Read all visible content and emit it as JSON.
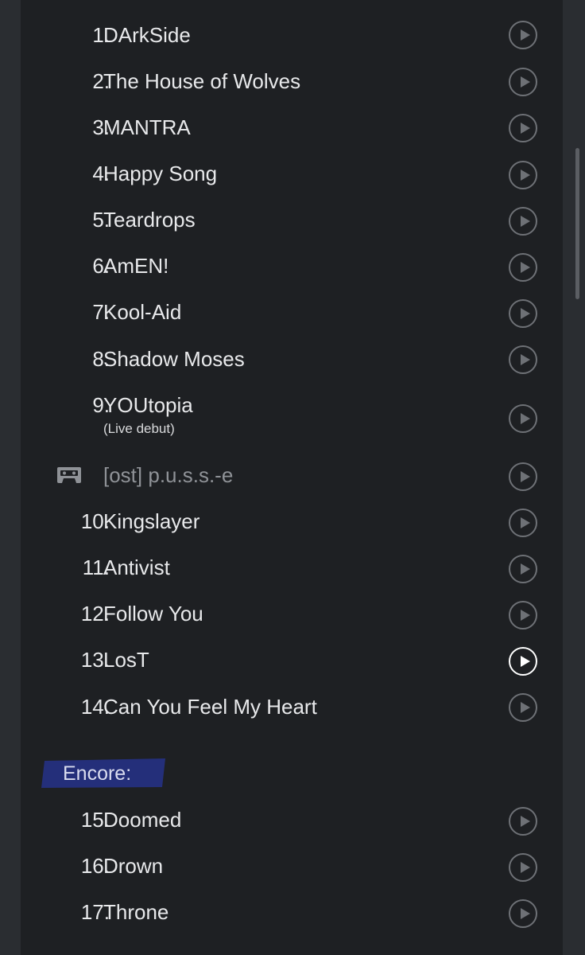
{
  "setlist": {
    "main": [
      {
        "number": "1.",
        "title": "DArkSide"
      },
      {
        "number": "2.",
        "title": "The House of Wolves"
      },
      {
        "number": "3.",
        "title": "MANTRA"
      },
      {
        "number": "4.",
        "title": "Happy Song"
      },
      {
        "number": "5.",
        "title": "Teardrops"
      },
      {
        "number": "6.",
        "title": "AmEN!"
      },
      {
        "number": "7.",
        "title": "Kool-Aid"
      },
      {
        "number": "8.",
        "title": "Shadow Moses"
      },
      {
        "number": "9.",
        "title": "YOUtopia",
        "note": "(Live debut)"
      }
    ],
    "tape": {
      "title": "[ost] p.u.s.s.-e",
      "icon": "cassette-tape-icon"
    },
    "main_cont": [
      {
        "number": "10.",
        "title": "Kingslayer"
      },
      {
        "number": "11.",
        "title": "Antivist"
      },
      {
        "number": "12.",
        "title": "Follow You"
      },
      {
        "number": "13.",
        "title": "LosT",
        "active": true
      },
      {
        "number": "14.",
        "title": "Can You Feel My Heart"
      }
    ],
    "encore_label": "Encore:",
    "encore": [
      {
        "number": "15.",
        "title": "Doomed"
      },
      {
        "number": "16.",
        "title": "Drown"
      },
      {
        "number": "17.",
        "title": "Throne"
      }
    ]
  },
  "icons": {
    "play": "play-circle-icon",
    "tape": "cassette-tape-icon"
  },
  "colors": {
    "background": "#1e2023",
    "frame": "#2a2d31",
    "text": "#e8e9eb",
    "muted_text": "#8f9297",
    "play_icon": "#6e7176",
    "play_icon_active": "#ffffff",
    "encore_highlight": "#26338a"
  }
}
